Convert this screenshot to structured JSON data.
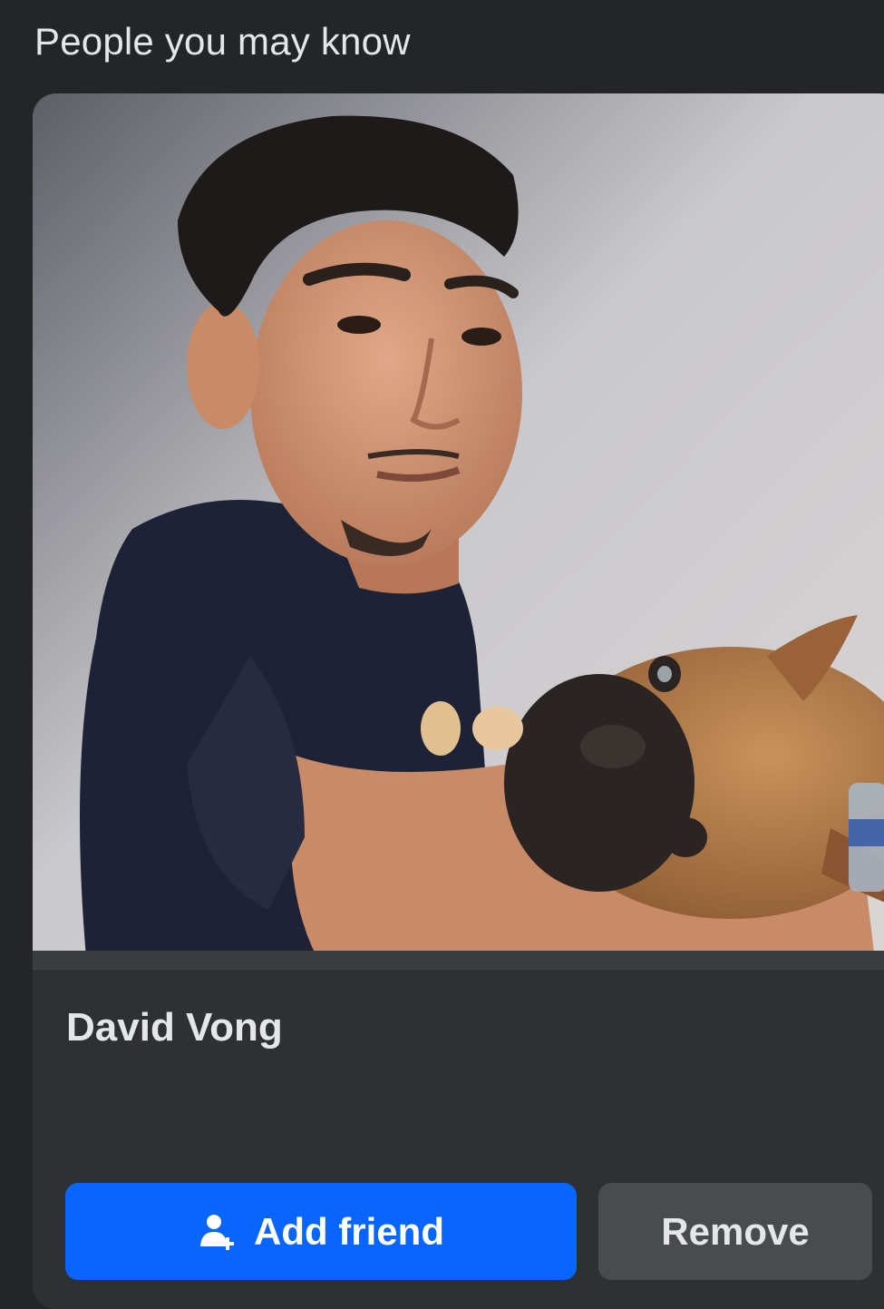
{
  "section": {
    "title": "People you may know"
  },
  "card": {
    "photo_alt": "profile-photo",
    "name": "David Vong",
    "add_friend_label": "Add friend",
    "remove_label": "Remove"
  },
  "icons": {
    "add_friend": "person-plus-icon"
  },
  "colors": {
    "background": "#242526",
    "card": "#2f3031",
    "primary_button": "#0866ff",
    "secondary_button": "#4a4b4d",
    "text": "#e4e6eb"
  }
}
